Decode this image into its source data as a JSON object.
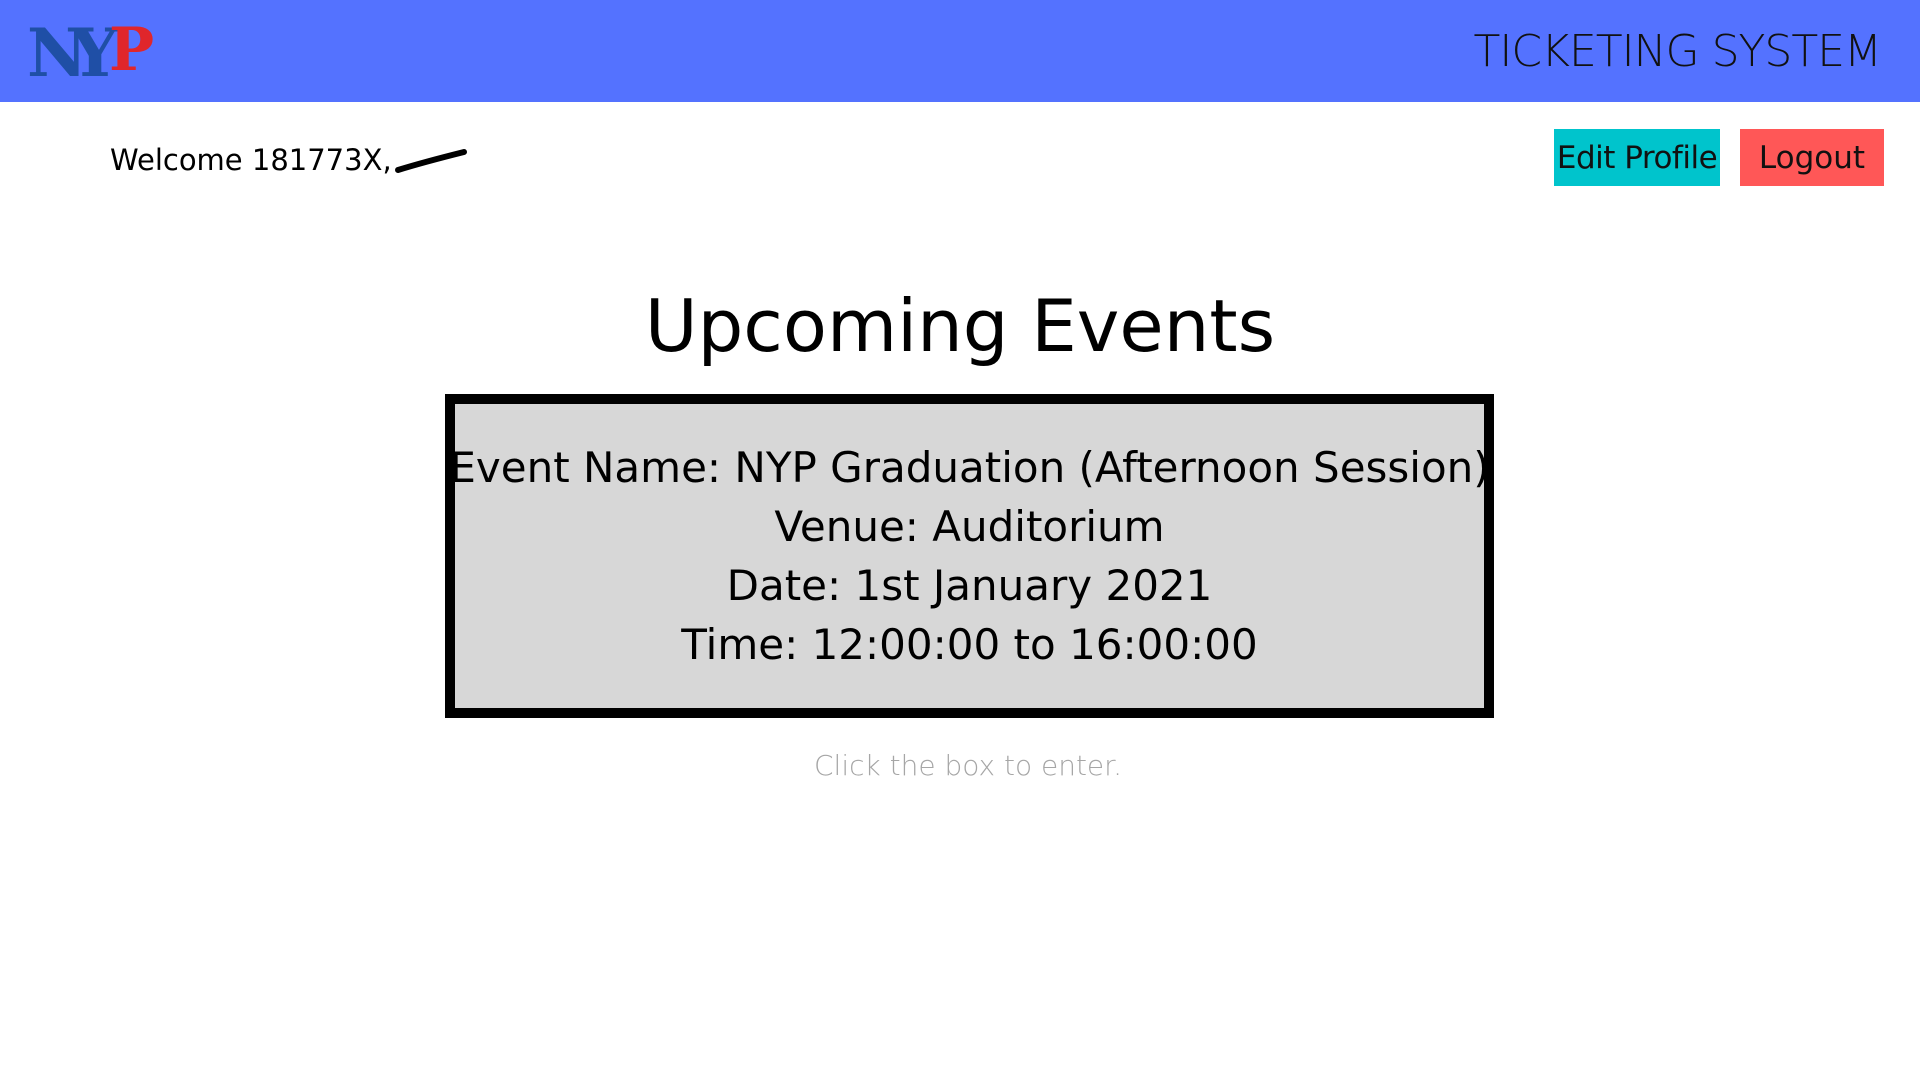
{
  "header": {
    "logo_text": "NYP",
    "system_title": "TICKETING SYSTEM"
  },
  "user_bar": {
    "welcome_text": "Welcome 181773X,",
    "edit_profile_label": "Edit Profile",
    "logout_label": "Logout"
  },
  "main": {
    "title": "Upcoming Events",
    "event": {
      "name_line": "Event Name: NYP Graduation (Afternoon Session)",
      "venue_line": "Venue: Auditorium",
      "date_line": "Date: 1st January 2021",
      "time_line": "Time: 12:00:00 to 16:00:00"
    },
    "hint": "Click the box to enter."
  },
  "colors": {
    "header_bg": "#5472ff",
    "edit_profile_bg": "#00c4cc",
    "logout_bg": "#ff5757",
    "event_card_bg": "#d7d7d7",
    "hint_text": "#a6a6a6",
    "logo_blue": "#1f4fa6",
    "logo_red": "#e0262b"
  },
  "icons": {
    "logo": "nyp-logo",
    "redaction": "redaction-scribble"
  }
}
